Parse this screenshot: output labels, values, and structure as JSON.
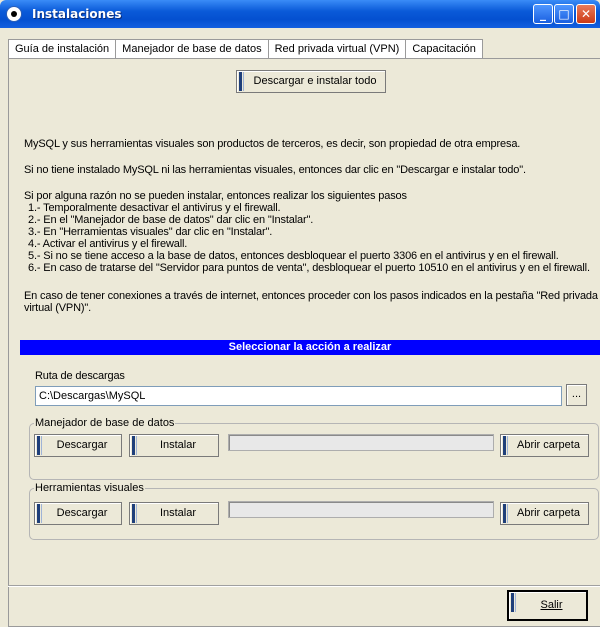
{
  "window": {
    "title": "Instalaciones",
    "controls": {
      "minimize": "_",
      "maximize": "□",
      "close": "✕"
    }
  },
  "tabs": [
    {
      "label": "Guía de instalación"
    },
    {
      "label": "Manejador de base de datos"
    },
    {
      "label": "Red privada virtual (VPN)"
    },
    {
      "label": "Capacitación"
    }
  ],
  "top_button": "Descargar e instalar todo",
  "info": {
    "line1": "MySQL y sus herramientas visuales son productos de terceros, es decir, son propiedad de otra empresa.",
    "line2": "Si no tiene instalado MySQL ni las herramientas visuales, entonces dar clic en \"Descargar e instalar todo\".",
    "steps_intro": "Si por alguna razón no se pueden instalar, entonces realizar los siguientes pasos",
    "steps": [
      "1.- Temporalmente desactivar el antivirus y el firewall.",
      "2.- En el \"Manejador de base de datos\" dar clic en \"Instalar\".",
      "3.- En \"Herramientas visuales\" dar clic en \"Instalar\".",
      "4.- Activar el antivirus y el firewall.",
      "5.- Si no se tiene acceso a la base de datos, entonces desbloquear el puerto 3306 en el antivirus y en el firewall.",
      "6.- En caso de tratarse del \"Servidor para puntos de venta\", desbloquear el puerto 10510 en el antivirus y en el firewall."
    ],
    "vpn_line1": "En caso de tener conexiones a través de internet, entonces proceder con los pasos indicados en la pestaña \"Red privada",
    "vpn_line2": "virtual (VPN)\"."
  },
  "action_header": "Seleccionar la acción a realizar",
  "download_path": {
    "label": "Ruta de descargas",
    "value": "C:\\Descargas\\MySQL",
    "browse": "..."
  },
  "groups": {
    "db": {
      "legend": "Manejador de base de datos",
      "download": "Descargar",
      "install": "Instalar",
      "progress": 0,
      "open_folder": "Abrir carpeta"
    },
    "tools": {
      "legend": "Herramientas visuales",
      "download": "Descargar",
      "install": "Instalar",
      "progress": 0,
      "open_folder": "Abrir carpeta"
    }
  },
  "exit_button": "Salir"
}
